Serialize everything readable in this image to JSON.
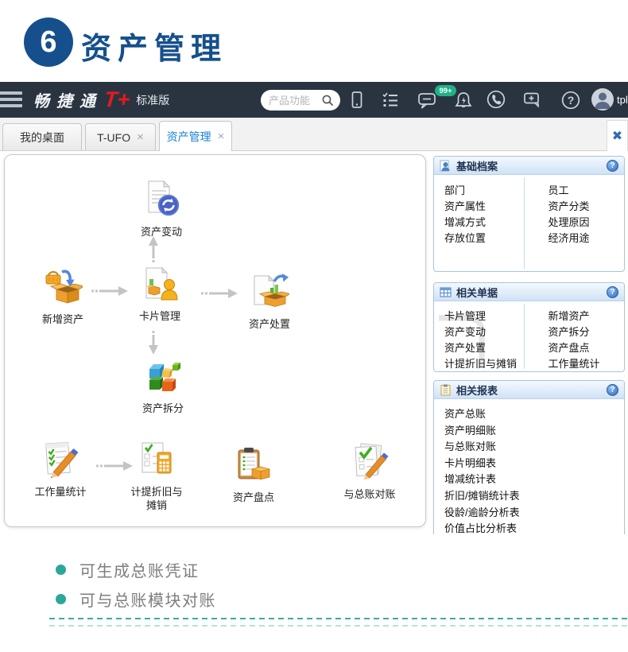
{
  "page": {
    "badge_number": "6",
    "title": "资产管理",
    "accent_color": "#15508c"
  },
  "navbar": {
    "brand": "畅捷通",
    "brand_t": "T+",
    "edition": "标准版",
    "search_placeholder": "产品功能",
    "notification_badge": "99+",
    "username": "tpl",
    "bg_color": "#2a3441",
    "logo_red": "#e8191d",
    "badge_green": "#1fb287"
  },
  "tabbar": {
    "tabs": [
      {
        "label": "我的桌面",
        "closable": false,
        "active": false
      },
      {
        "label": "T-UFO",
        "closable": true,
        "active": false
      },
      {
        "label": "资产管理",
        "closable": true,
        "active": true
      }
    ],
    "close_symbol": "×",
    "close_all_symbol": "✖"
  },
  "flowchart": {
    "nodes": [
      {
        "id": "asset-change",
        "label": "资产变动"
      },
      {
        "id": "new-asset",
        "label": "新增资产"
      },
      {
        "id": "card-management",
        "label": "卡片管理"
      },
      {
        "id": "asset-disposal",
        "label": "资产处置"
      },
      {
        "id": "asset-split",
        "label": "资产拆分"
      },
      {
        "id": "workload-stats",
        "label": "工作量统计"
      },
      {
        "id": "depreciation-amortization",
        "label": "计提折旧与摊销"
      },
      {
        "id": "asset-inventory",
        "label": "资产盘点"
      },
      {
        "id": "gl-reconciliation",
        "label": "与总账对账"
      }
    ]
  },
  "panels": {
    "basic_archives": {
      "title": "基础档案",
      "help_symbol": "?",
      "col_left": [
        "部门",
        "资产属性",
        "增减方式",
        "存放位置"
      ],
      "col_right": [
        "员工",
        "资产分类",
        "处理原因",
        "经济用途"
      ]
    },
    "related_documents": {
      "title": "相关单据",
      "help_symbol": "?",
      "col_left": [
        "卡片管理",
        "资产变动",
        "资产处置",
        "计提折旧与摊销"
      ],
      "col_right": [
        "新增资产",
        "资产拆分",
        "资产盘点",
        "工作量统计"
      ]
    },
    "related_reports": {
      "title": "相关报表",
      "help_symbol": "?",
      "items": [
        "资产总账",
        "资产明细账",
        "与总账对账",
        "卡片明细表",
        "增减统计表",
        "折旧/摊销统计表",
        "役龄/逾龄分析表",
        "价值占比分析表"
      ]
    }
  },
  "notes": {
    "bullets": [
      "可生成总账凭证",
      "可与总账模块对账"
    ]
  }
}
